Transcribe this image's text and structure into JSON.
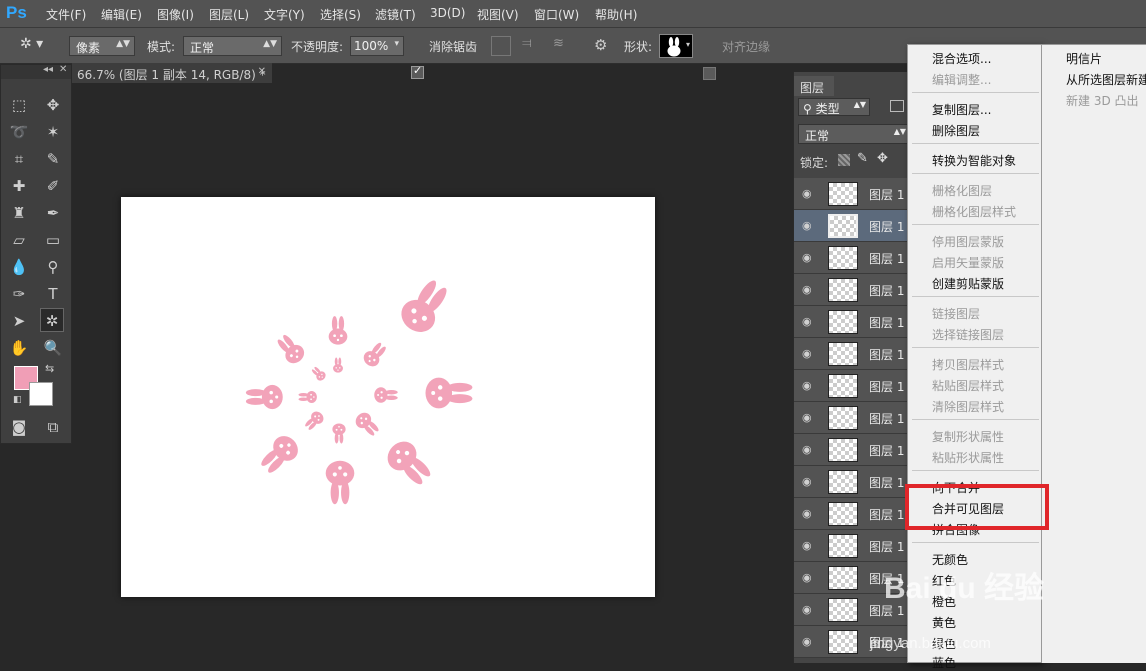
{
  "app": {
    "logo": "Ps"
  },
  "menu": [
    "文件(F)",
    "编辑(E)",
    "图像(I)",
    "图层(L)",
    "文字(Y)",
    "选择(S)",
    "滤镜(T)",
    "3D(D)",
    "视图(V)",
    "窗口(W)",
    "帮助(H)"
  ],
  "options": {
    "mode_type": "像素",
    "mode_label": "模式:",
    "mode_value": "正常",
    "opacity_label": "不透明度:",
    "opacity_value": "100%",
    "antialias_label": "消除锯齿",
    "shape_label": "形状:",
    "align_edges_label": "对齐边缘"
  },
  "document": {
    "tab_title": "66.7% (图层 1 副本 14, RGB/8) *"
  },
  "layers": {
    "tab": "图层",
    "filter_kind": "类型",
    "blend_mode": "正常",
    "lock_label": "锁定:",
    "rows": [
      "图层 1",
      "图层 1",
      "图层 1",
      "图层 1",
      "图层 1",
      "图层 1",
      "图层 1",
      "图层 1",
      "图层 1",
      "图层 1",
      "图层 1",
      "图层 1",
      "图层 1",
      "图层 1",
      "图层 1"
    ]
  },
  "context_menu": {
    "items": [
      {
        "label": "混合选项...",
        "enabled": true
      },
      {
        "label": "编辑调整...",
        "enabled": false
      },
      {
        "label": "复制图层...",
        "enabled": true
      },
      {
        "label": "删除图层",
        "enabled": true
      },
      {
        "label": "转换为智能对象",
        "enabled": true
      },
      {
        "label": "栅格化图层",
        "enabled": false
      },
      {
        "label": "栅格化图层样式",
        "enabled": false
      },
      {
        "label": "停用图层蒙版",
        "enabled": false
      },
      {
        "label": "启用矢量蒙版",
        "enabled": false
      },
      {
        "label": "创建剪贴蒙版",
        "enabled": true
      },
      {
        "label": "链接图层",
        "enabled": false
      },
      {
        "label": "选择链接图层",
        "enabled": false
      },
      {
        "label": "拷贝图层样式",
        "enabled": false
      },
      {
        "label": "粘贴图层样式",
        "enabled": false
      },
      {
        "label": "清除图层样式",
        "enabled": false
      },
      {
        "label": "复制形状属性",
        "enabled": false
      },
      {
        "label": "粘贴形状属性",
        "enabled": false
      },
      {
        "label": "向下合并",
        "enabled": true
      },
      {
        "label": "合并可见图层",
        "enabled": true
      },
      {
        "label": "拼合图像",
        "enabled": true
      },
      {
        "label": "无颜色",
        "enabled": true
      },
      {
        "label": "红色",
        "enabled": true
      },
      {
        "label": "橙色",
        "enabled": true
      },
      {
        "label": "黄色",
        "enabled": true
      },
      {
        "label": "绿色",
        "enabled": true
      },
      {
        "label": "蓝色",
        "enabled": true
      }
    ],
    "submenu": [
      {
        "label": "明信片",
        "enabled": true
      },
      {
        "label": "从所选图层新建",
        "enabled": true
      },
      {
        "label": "新建 3D 凸出",
        "enabled": false
      }
    ],
    "highlighted": "合并可见图层"
  },
  "watermark": {
    "brand": "Bai du 经验",
    "url": "jingyan.baidu.com"
  },
  "colors": {
    "foreground": "#f09eb6",
    "background": "#ffffff",
    "bunny": "#f2a3b9",
    "highlight_border": "#e0262a"
  }
}
